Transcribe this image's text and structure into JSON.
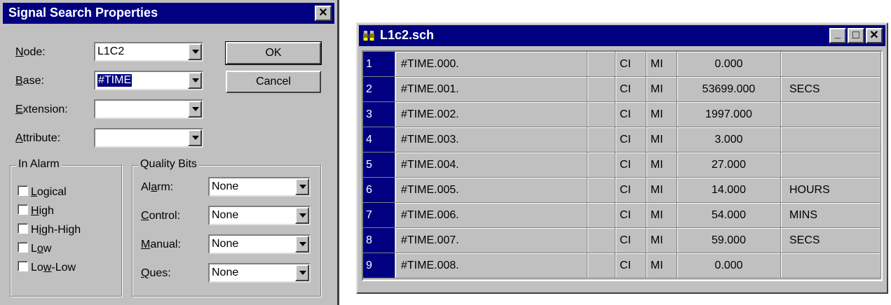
{
  "dialog": {
    "title": "Signal Search Properties",
    "close_glyph": "✕",
    "node": {
      "label_u": "N",
      "label_rest": "ode:",
      "value": "L1C2"
    },
    "base": {
      "label_u": "B",
      "label_rest": "ase:",
      "value": "#TIME"
    },
    "extension": {
      "label_u": "E",
      "label_rest": "xtension:",
      "value": ""
    },
    "attribute": {
      "label_u": "A",
      "label_rest": "ttribute:",
      "value": ""
    },
    "ok_label": "OK",
    "cancel_label": "Cancel",
    "in_alarm": {
      "title": "In Alarm",
      "items": [
        {
          "pre": "",
          "u": "L",
          "post": "ogical",
          "checked": false
        },
        {
          "pre": "",
          "u": "H",
          "post": "igh",
          "checked": false
        },
        {
          "pre": "H",
          "u": "i",
          "post": "gh-High",
          "checked": false
        },
        {
          "pre": "L",
          "u": "o",
          "post": "w",
          "checked": false
        },
        {
          "pre": "Lo",
          "u": "w",
          "post": "-Low",
          "checked": false
        }
      ]
    },
    "quality_bits": {
      "title": "Quality Bits",
      "items": [
        {
          "pre": "Al",
          "u": "a",
          "post": "rm:",
          "value": "None"
        },
        {
          "pre": "",
          "u": "C",
          "post": "ontrol:",
          "value": "None"
        },
        {
          "pre": "",
          "u": "M",
          "post": "anual:",
          "value": "None"
        },
        {
          "pre": "",
          "u": "Q",
          "post": "ues:",
          "value": "None"
        }
      ]
    }
  },
  "table_window": {
    "title": "L1c2.sch",
    "minimize_glyph": "_",
    "maximize_glyph": "□",
    "close_glyph": "✕",
    "rows": [
      {
        "num": "1",
        "name": "#TIME.000.",
        "blank": "",
        "cl": "CI",
        "mi": "MI",
        "value": "0.000",
        "unit": ""
      },
      {
        "num": "2",
        "name": "#TIME.001.",
        "blank": "",
        "cl": "CI",
        "mi": "MI",
        "value": "53699.000",
        "unit": "SECS"
      },
      {
        "num": "3",
        "name": "#TIME.002.",
        "blank": "",
        "cl": "CI",
        "mi": "MI",
        "value": "1997.000",
        "unit": ""
      },
      {
        "num": "4",
        "name": "#TIME.003.",
        "blank": "",
        "cl": "CI",
        "mi": "MI",
        "value": "3.000",
        "unit": ""
      },
      {
        "num": "5",
        "name": "#TIME.004.",
        "blank": "",
        "cl": "CI",
        "mi": "MI",
        "value": "27.000",
        "unit": ""
      },
      {
        "num": "6",
        "name": "#TIME.005.",
        "blank": "",
        "cl": "CI",
        "mi": "MI",
        "value": "14.000",
        "unit": "HOURS"
      },
      {
        "num": "7",
        "name": "#TIME.006.",
        "blank": "",
        "cl": "CI",
        "mi": "MI",
        "value": "54.000",
        "unit": "MINS"
      },
      {
        "num": "8",
        "name": "#TIME.007.",
        "blank": "",
        "cl": "CI",
        "mi": "MI",
        "value": "59.000",
        "unit": "SECS"
      },
      {
        "num": "9",
        "name": "#TIME.008.",
        "blank": "",
        "cl": "CI",
        "mi": "MI",
        "value": "0.000",
        "unit": ""
      }
    ]
  },
  "colors": {
    "titlebar": "#000080",
    "face": "#c0c0c0",
    "rownum_bg": "#000080"
  }
}
